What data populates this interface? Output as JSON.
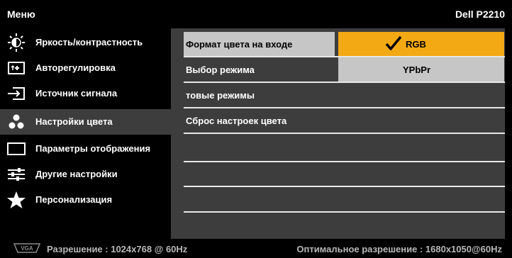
{
  "header": {
    "menu_title": "Меню",
    "model": "Dell P2210"
  },
  "sidebar": {
    "items": [
      {
        "label": "Яркость/контрастность",
        "icon": "brightness-icon"
      },
      {
        "label": "Авторегулировка",
        "icon": "auto-adjust-icon"
      },
      {
        "label": "Источник сигнала",
        "icon": "input-source-icon"
      },
      {
        "label": "Настройки цвета",
        "icon": "color-settings-icon",
        "active": true
      },
      {
        "label": "Параметры отображения",
        "icon": "display-settings-icon"
      },
      {
        "label": "Другие настройки",
        "icon": "other-settings-icon"
      },
      {
        "label": "Персонализация",
        "icon": "star-icon"
      }
    ]
  },
  "main": {
    "rows": [
      {
        "label": "Формат цвета на входе"
      },
      {
        "label": "Выбор режима"
      },
      {
        "label": "товые режимы"
      },
      {
        "label": "Сброс настроек цвета"
      }
    ],
    "options": [
      {
        "label": "RGB",
        "selected": true
      },
      {
        "label": "YPbPr"
      }
    ]
  },
  "status": {
    "resolution": "Разрешение : 1024x768 @ 60Hz",
    "optimal": "Оптимальное разрешение : 1680x1050@60Hz",
    "vga_label": "VGA"
  },
  "colors": {
    "accent": "#f3a914",
    "panel": "#3d3d3d",
    "selected_row": "#c6c6c6"
  }
}
